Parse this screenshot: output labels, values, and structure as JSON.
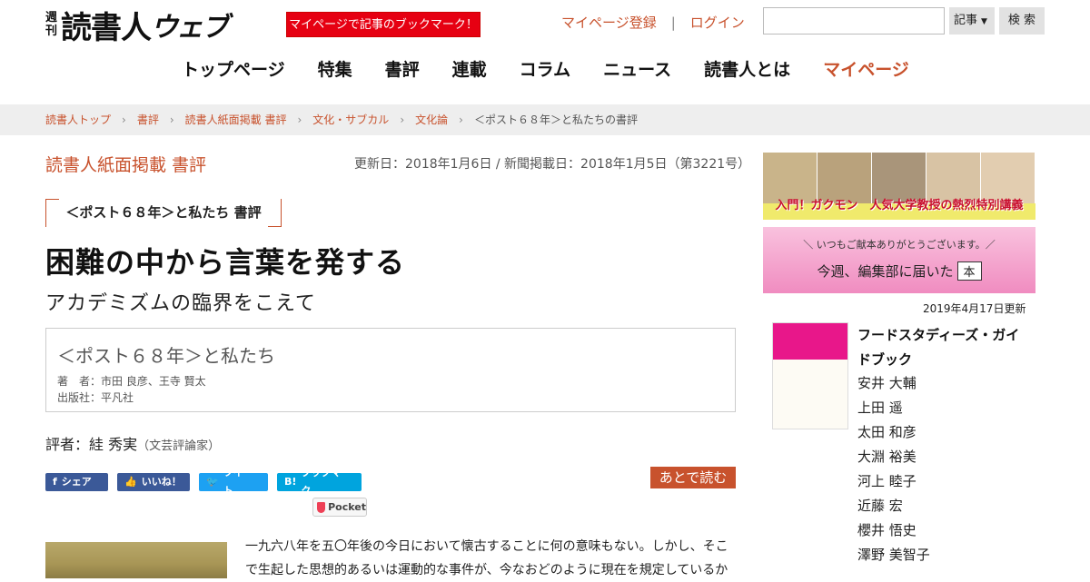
{
  "header": {
    "logo_shuukan_1": "週",
    "logo_shuukan_2": "刊",
    "logo_main": "読書人",
    "logo_web": "ウェブ",
    "bookmark_banner": "マイページで記事のブックマーク！",
    "register_link": "マイページ登録",
    "separator": "|",
    "login_link": "ログイン",
    "search_placeholder": "",
    "search_select": "記事",
    "search_button": "検 索"
  },
  "nav": {
    "items": [
      "トップページ",
      "特集",
      "書評",
      "連載",
      "コラム",
      "ニュース",
      "読書人とは",
      "マイページ"
    ]
  },
  "breadcrumb": [
    "読書人トップ",
    "書評",
    "読書人紙面掲載 書評",
    "文化・サブカル",
    "文化論",
    "＜ポスト６８年＞と私たちの書評"
  ],
  "article": {
    "category": "読書人紙面掲載 書評",
    "dates": "更新日：2018年1月6日 / 新聞掲載日：2018年1月5日（第3221号）",
    "book_tag": "＜ポスト６８年＞と私たち 書評",
    "headline": "困難の中から言葉を発する",
    "subhead": "アカデミズムの臨界をこえて",
    "book_title": "＜ポスト６８年＞と私たち",
    "book_author": "著　者：市田 良彦、王寺 賢太",
    "book_publisher": "出版社：平凡社",
    "reviewer_label": "評者：",
    "reviewer_name": "絓 秀実",
    "reviewer_role": "（文芸評論家）",
    "share_fb": "シェア",
    "share_like": "いいね！",
    "share_tw": "ツイート",
    "share_hb": "ブックマーク",
    "share_hb_icon": "B!",
    "later": "あとで読む",
    "pocket": "Pocket",
    "body_line1": "一九六八年を五〇年後の今日において懐古することに何の意味もない。しかし、そこ",
    "body_line2": "で生起した思想的あるいは運動的な事件が、今なおどのように現在を規定しているか"
  },
  "sidebar": {
    "ad1_caption": "入門！ガクモン　人気大学教授の熱烈特別講義",
    "ad2_small": "＼ いつもご献本ありがとうございます。／",
    "ad2_big": "今週、編集部に届いた",
    "ad2_bookicon": "本",
    "updated": "2019年4月17日更新",
    "book_title": "フードスタディーズ・ガイドブック",
    "authors": [
      "安井 大輔",
      "上田 遥",
      "太田 和彦",
      "大淵 裕美",
      "河上 睦子",
      "近藤 宏",
      "櫻井 悟史",
      "澤野 美智子"
    ]
  },
  "colors": {
    "accent": "#c8522d",
    "banner_red": "#e60012",
    "breadcrumb_bg": "#eeeeee",
    "facebook": "#3b5998",
    "twitter": "#1da1f2",
    "hatena": "#00a4de"
  }
}
